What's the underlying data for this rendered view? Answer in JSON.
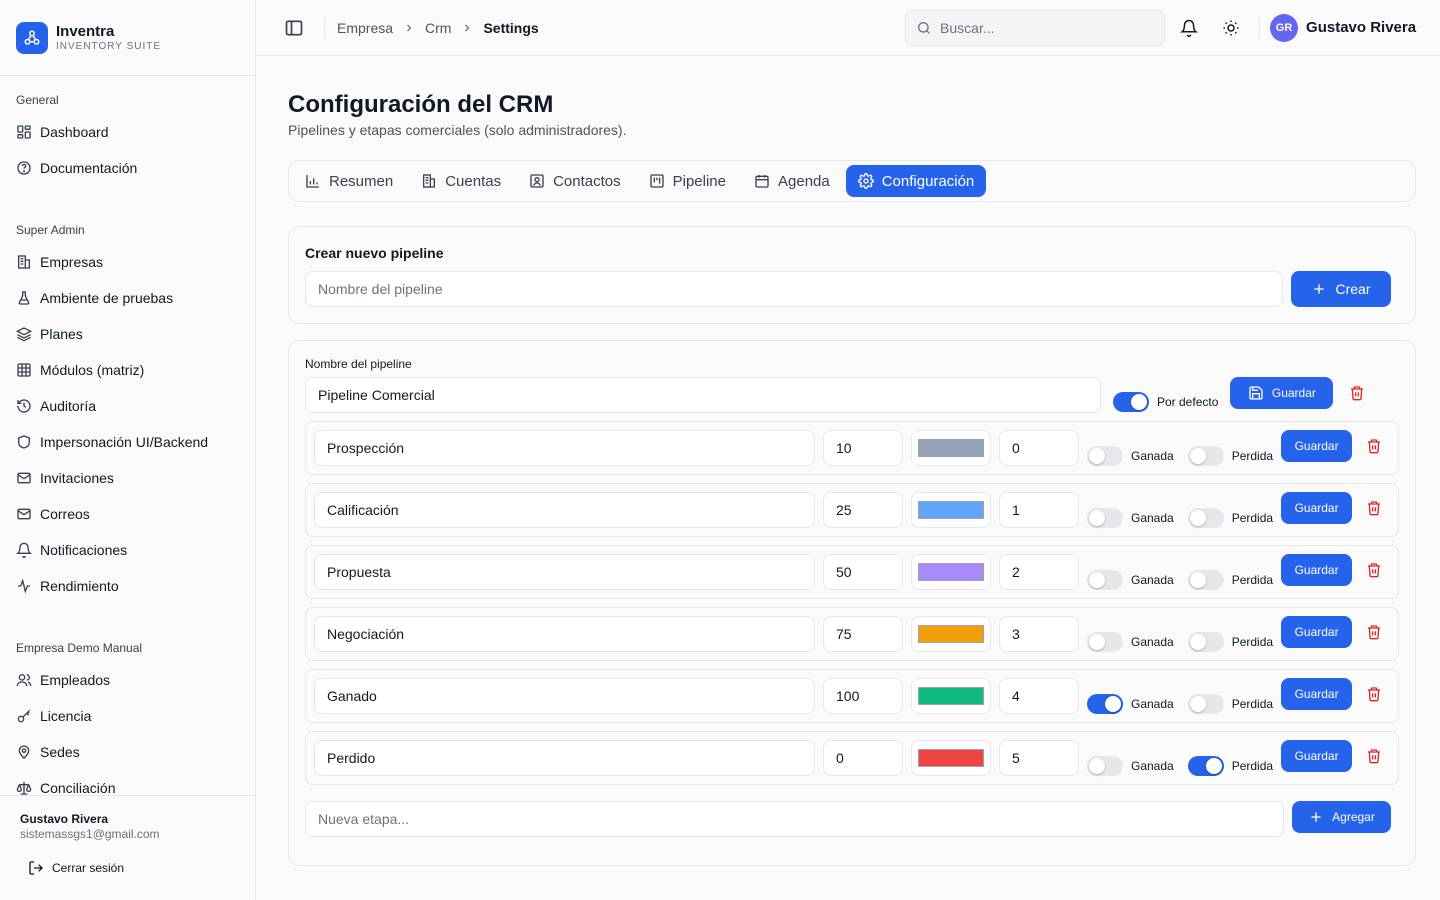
{
  "brand": {
    "name": "Inventra",
    "subtitle": "INVENTORY SUITE"
  },
  "sidebar": {
    "sections": [
      {
        "title": "General",
        "items": [
          {
            "label": "Dashboard",
            "icon": "layout-grid-icon"
          },
          {
            "label": "Documentación",
            "icon": "help-circle-icon"
          }
        ]
      },
      {
        "title": "Super Admin",
        "items": [
          {
            "label": "Empresas",
            "icon": "building-icon"
          },
          {
            "label": "Ambiente de pruebas",
            "icon": "flask-icon"
          },
          {
            "label": "Planes",
            "icon": "layers-icon"
          },
          {
            "label": "Módulos (matriz)",
            "icon": "table-icon"
          },
          {
            "label": "Auditoría",
            "icon": "history-icon"
          },
          {
            "label": "Impersonación UI/Backend",
            "icon": "shield-icon"
          },
          {
            "label": "Invitaciones",
            "icon": "mail-icon"
          },
          {
            "label": "Correos",
            "icon": "mail-icon"
          },
          {
            "label": "Notificaciones",
            "icon": "bell-icon"
          },
          {
            "label": "Rendimiento",
            "icon": "activity-icon"
          }
        ]
      },
      {
        "title": "Empresa Demo Manual",
        "items": [
          {
            "label": "Empleados",
            "icon": "users-icon"
          },
          {
            "label": "Licencia",
            "icon": "key-icon"
          },
          {
            "label": "Sedes",
            "icon": "map-pin-icon"
          },
          {
            "label": "Conciliación",
            "icon": "scale-icon"
          }
        ]
      }
    ],
    "footer": {
      "user_name": "Gustavo Rivera",
      "user_email": "sistemassgs1@gmail.com",
      "logout_label": "Cerrar sesión"
    }
  },
  "topbar": {
    "breadcrumb": [
      "Empresa",
      "Crm",
      "Settings"
    ],
    "search_placeholder": "Buscar...",
    "avatar_initials": "GR",
    "user_name": "Gustavo Rivera"
  },
  "page": {
    "title": "Configuración del CRM",
    "subtitle": "Pipelines y etapas comerciales (solo administradores)."
  },
  "tabs": [
    {
      "label": "Resumen",
      "icon": "bar-chart-icon",
      "active": false
    },
    {
      "label": "Cuentas",
      "icon": "building-icon",
      "active": false
    },
    {
      "label": "Contactos",
      "icon": "contact-icon",
      "active": false
    },
    {
      "label": "Pipeline",
      "icon": "kanban-icon",
      "active": false
    },
    {
      "label": "Agenda",
      "icon": "calendar-icon",
      "active": false
    },
    {
      "label": "Configuración",
      "icon": "gear-icon",
      "active": true
    }
  ],
  "create_pipeline": {
    "title": "Crear nuevo pipeline",
    "placeholder": "Nombre del pipeline",
    "button_label": "Crear"
  },
  "pipeline": {
    "name_label": "Nombre del pipeline",
    "name_value": "Pipeline Comercial",
    "default_label": "Por defecto",
    "is_default": true,
    "save_label": "Guardar",
    "won_label": "Ganada",
    "lost_label": "Perdida",
    "stages": [
      {
        "name": "Prospección",
        "probability": "10",
        "color": "#94a3b8",
        "order": "0",
        "won": false,
        "lost": false
      },
      {
        "name": "Calificación",
        "probability": "25",
        "color": "#60a5fa",
        "order": "1",
        "won": false,
        "lost": false
      },
      {
        "name": "Propuesta",
        "probability": "50",
        "color": "#a78bfa",
        "order": "2",
        "won": false,
        "lost": false
      },
      {
        "name": "Negociación",
        "probability": "75",
        "color": "#f59e0b",
        "order": "3",
        "won": false,
        "lost": false
      },
      {
        "name": "Ganado",
        "probability": "100",
        "color": "#10b981",
        "order": "4",
        "won": true,
        "lost": false
      },
      {
        "name": "Perdido",
        "probability": "0",
        "color": "#ef4444",
        "order": "5",
        "won": false,
        "lost": true
      }
    ],
    "new_stage_placeholder": "Nueva etapa...",
    "add_label": "Agregar"
  },
  "colors": {
    "primary": "#2563eb",
    "danger": "#dc2626"
  }
}
